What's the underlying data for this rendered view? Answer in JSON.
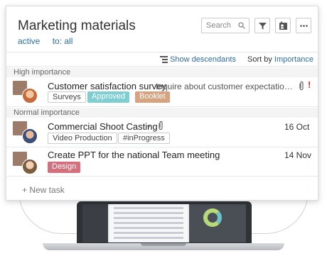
{
  "header": {
    "title": "Marketing materials",
    "filter_status": "active",
    "filter_to": "to: all",
    "search_placeholder": "Search"
  },
  "toolbar": {
    "show_descendants": "Show descendants",
    "sort_by_label": "Sort by",
    "sort_by_value": "Importance"
  },
  "groups": {
    "high": "High importance",
    "normal": "Normal importance"
  },
  "tasks": [
    {
      "title": "Customer satisfaction survey",
      "description": "Inquire about customer expectations a...",
      "tags": [
        "Surveys",
        "Approved",
        "Booklet"
      ],
      "important_mark": "!"
    },
    {
      "title": "Commercial Shoot Casting",
      "bullet": "•",
      "date": "16 Oct",
      "tags": [
        "Video Production",
        "#inProgress"
      ]
    },
    {
      "title": "Create PPT for the national Team meeting",
      "date": "14 Nov",
      "tags": [
        "Design"
      ]
    }
  ],
  "footer": {
    "new_task": "+ New task"
  },
  "colors": {
    "link": "#2b6ea8",
    "tag_approved": "#7fcfd2",
    "tag_booklet": "#d7a27f",
    "tag_design": "#d4707e",
    "important": "#d0393b"
  }
}
